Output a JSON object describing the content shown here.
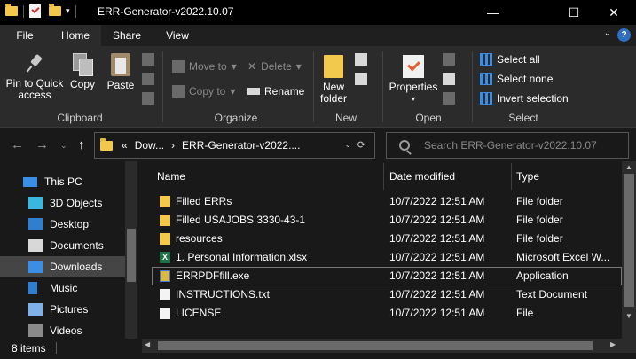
{
  "window": {
    "title": "ERR-Generator-v2022.10.07",
    "minimize": "—",
    "maximize": "☐",
    "close": "✕"
  },
  "tabs": [
    {
      "label": "File"
    },
    {
      "label": "Home"
    },
    {
      "label": "Share"
    },
    {
      "label": "View"
    }
  ],
  "ribbon": {
    "clipboard": {
      "label": "Clipboard",
      "pin_label_1": "Pin to Quick",
      "pin_label_2": "access",
      "copy": "Copy",
      "paste": "Paste"
    },
    "organize": {
      "label": "Organize",
      "move_to": "Move to",
      "copy_to": "Copy to",
      "delete": "Delete",
      "rename": "Rename"
    },
    "new": {
      "label": "New",
      "new_folder_1": "New",
      "new_folder_2": "folder"
    },
    "open": {
      "label": "Open",
      "properties": "Properties"
    },
    "select": {
      "label": "Select",
      "select_all": "Select all",
      "select_none": "Select none",
      "invert": "Invert selection"
    }
  },
  "address": {
    "prefix": "«",
    "crumb1": "Dow...",
    "crumb_sep": "›",
    "crumb2": "ERR-Generator-v2022....",
    "search_placeholder": "Search ERR-Generator-v2022.10.07"
  },
  "nav": {
    "items": [
      {
        "label": "This PC",
        "icon": "computer-icon"
      },
      {
        "label": "3D Objects",
        "icon": "cube-icon"
      },
      {
        "label": "Desktop",
        "icon": "desktop-icon"
      },
      {
        "label": "Documents",
        "icon": "document-icon"
      },
      {
        "label": "Downloads",
        "icon": "download-icon"
      },
      {
        "label": "Music",
        "icon": "music-icon"
      },
      {
        "label": "Pictures",
        "icon": "picture-icon"
      },
      {
        "label": "Videos",
        "icon": "video-icon"
      }
    ],
    "selected": "Downloads"
  },
  "columns": {
    "name": "Name",
    "date": "Date modified",
    "type": "Type"
  },
  "files": [
    {
      "name": "Filled ERRs",
      "date": "10/7/2022 12:51 AM",
      "type": "File folder",
      "icon": "folder-icon"
    },
    {
      "name": "Filled USAJOBS 3330-43-1",
      "date": "10/7/2022 12:51 AM",
      "type": "File folder",
      "icon": "folder-icon"
    },
    {
      "name": "resources",
      "date": "10/7/2022 12:51 AM",
      "type": "File folder",
      "icon": "folder-icon"
    },
    {
      "name": "1. Personal Information.xlsx",
      "date": "10/7/2022 12:51 AM",
      "type": "Microsoft Excel W...",
      "icon": "excel-icon"
    },
    {
      "name": "ERRPDFfill.exe",
      "date": "10/7/2022 12:51 AM",
      "type": "Application",
      "icon": "exe-icon"
    },
    {
      "name": "INSTRUCTIONS.txt",
      "date": "10/7/2022 12:51 AM",
      "type": "Text Document",
      "icon": "text-file-icon"
    },
    {
      "name": "LICENSE",
      "date": "10/7/2022 12:51 AM",
      "type": "File",
      "icon": "file-icon"
    }
  ],
  "selected_file": "ERRPDFfill.exe",
  "status": {
    "count": "8 items"
  }
}
